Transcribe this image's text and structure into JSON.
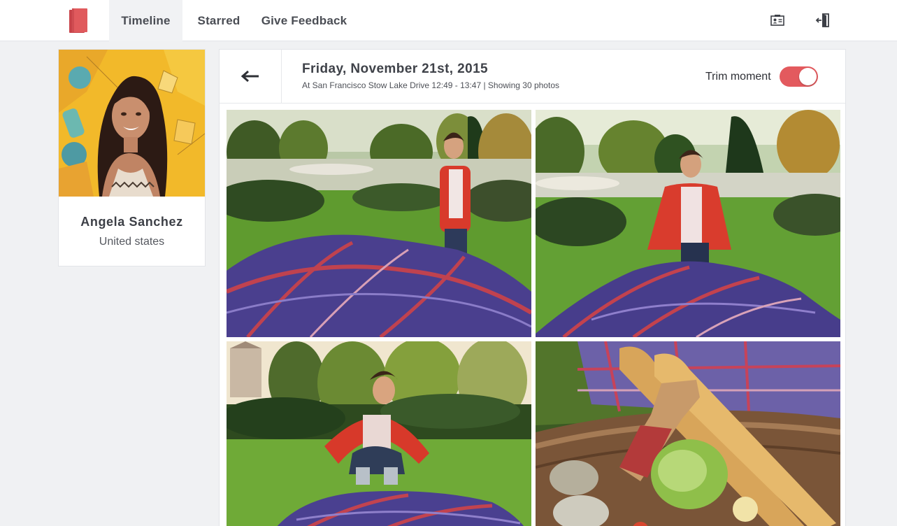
{
  "nav": {
    "tabs": [
      {
        "label": "Timeline",
        "active": true
      },
      {
        "label": "Starred",
        "active": false
      },
      {
        "label": "Give Feedback",
        "active": false
      }
    ],
    "icons": [
      "logo-icon",
      "profile-card-icon",
      "logout-icon"
    ]
  },
  "profile": {
    "name": "Angela Sanchez",
    "country": "United states"
  },
  "moment": {
    "title": "Friday, November 21st, 2015",
    "subtitle": "At San Francisco Stow Lake Drive 12:49 - 13:47 | Showing 30 photos",
    "trim_label": "Trim moment",
    "trim_enabled": true
  },
  "colors": {
    "accent": "#e35a5e",
    "logo": "#e05a5d"
  }
}
